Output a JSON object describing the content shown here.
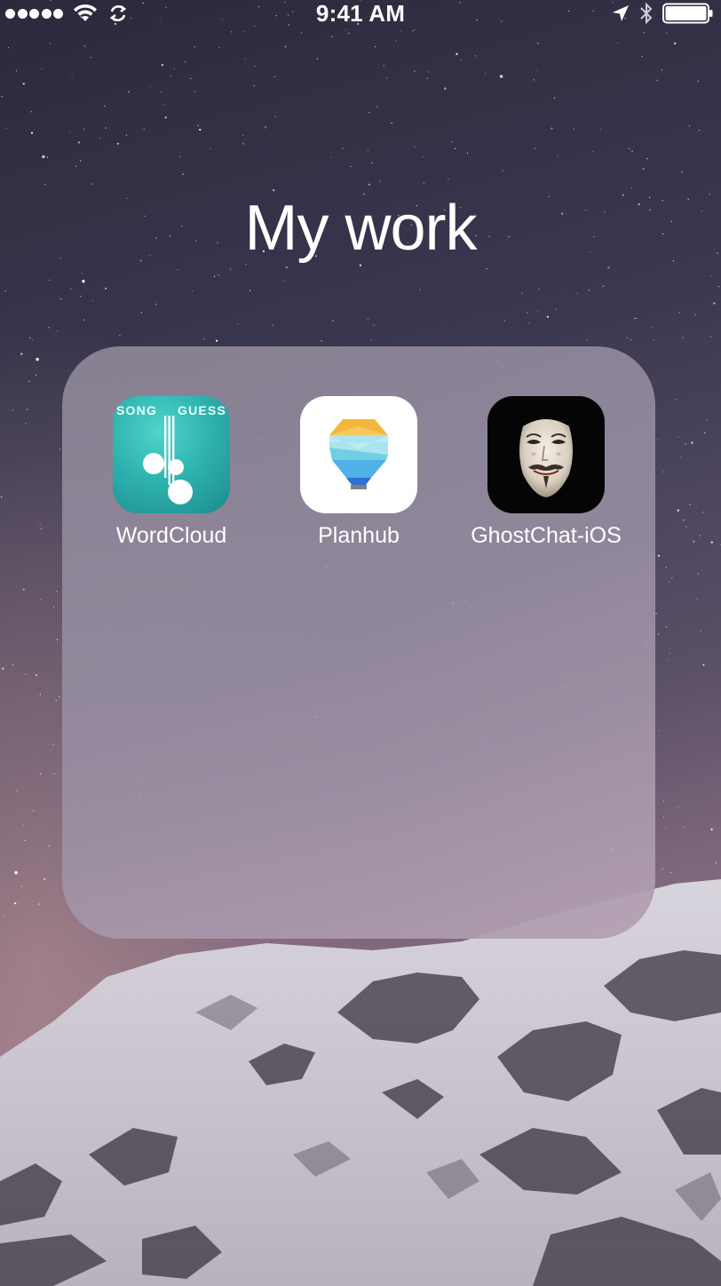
{
  "status_bar": {
    "time": "9:41 AM",
    "signal_bars": 5,
    "icons": [
      "wifi-icon",
      "sync-icon",
      "location-arrow-icon",
      "bluetooth-icon",
      "battery-icon"
    ],
    "battery_level": 1.0
  },
  "folder": {
    "title": "My work",
    "apps": [
      {
        "label": "WordCloud",
        "icon": "song-guess-icon",
        "icon_text_left": "SONG",
        "icon_text_right": "GUESS",
        "accent": "#2fb4b0"
      },
      {
        "label": "Planhub",
        "icon": "lightbulb-icon",
        "accent": "#f4b63c"
      },
      {
        "label": "GhostChat-iOS",
        "icon": "guy-fawkes-mask-icon",
        "accent": "#000000"
      }
    ]
  }
}
